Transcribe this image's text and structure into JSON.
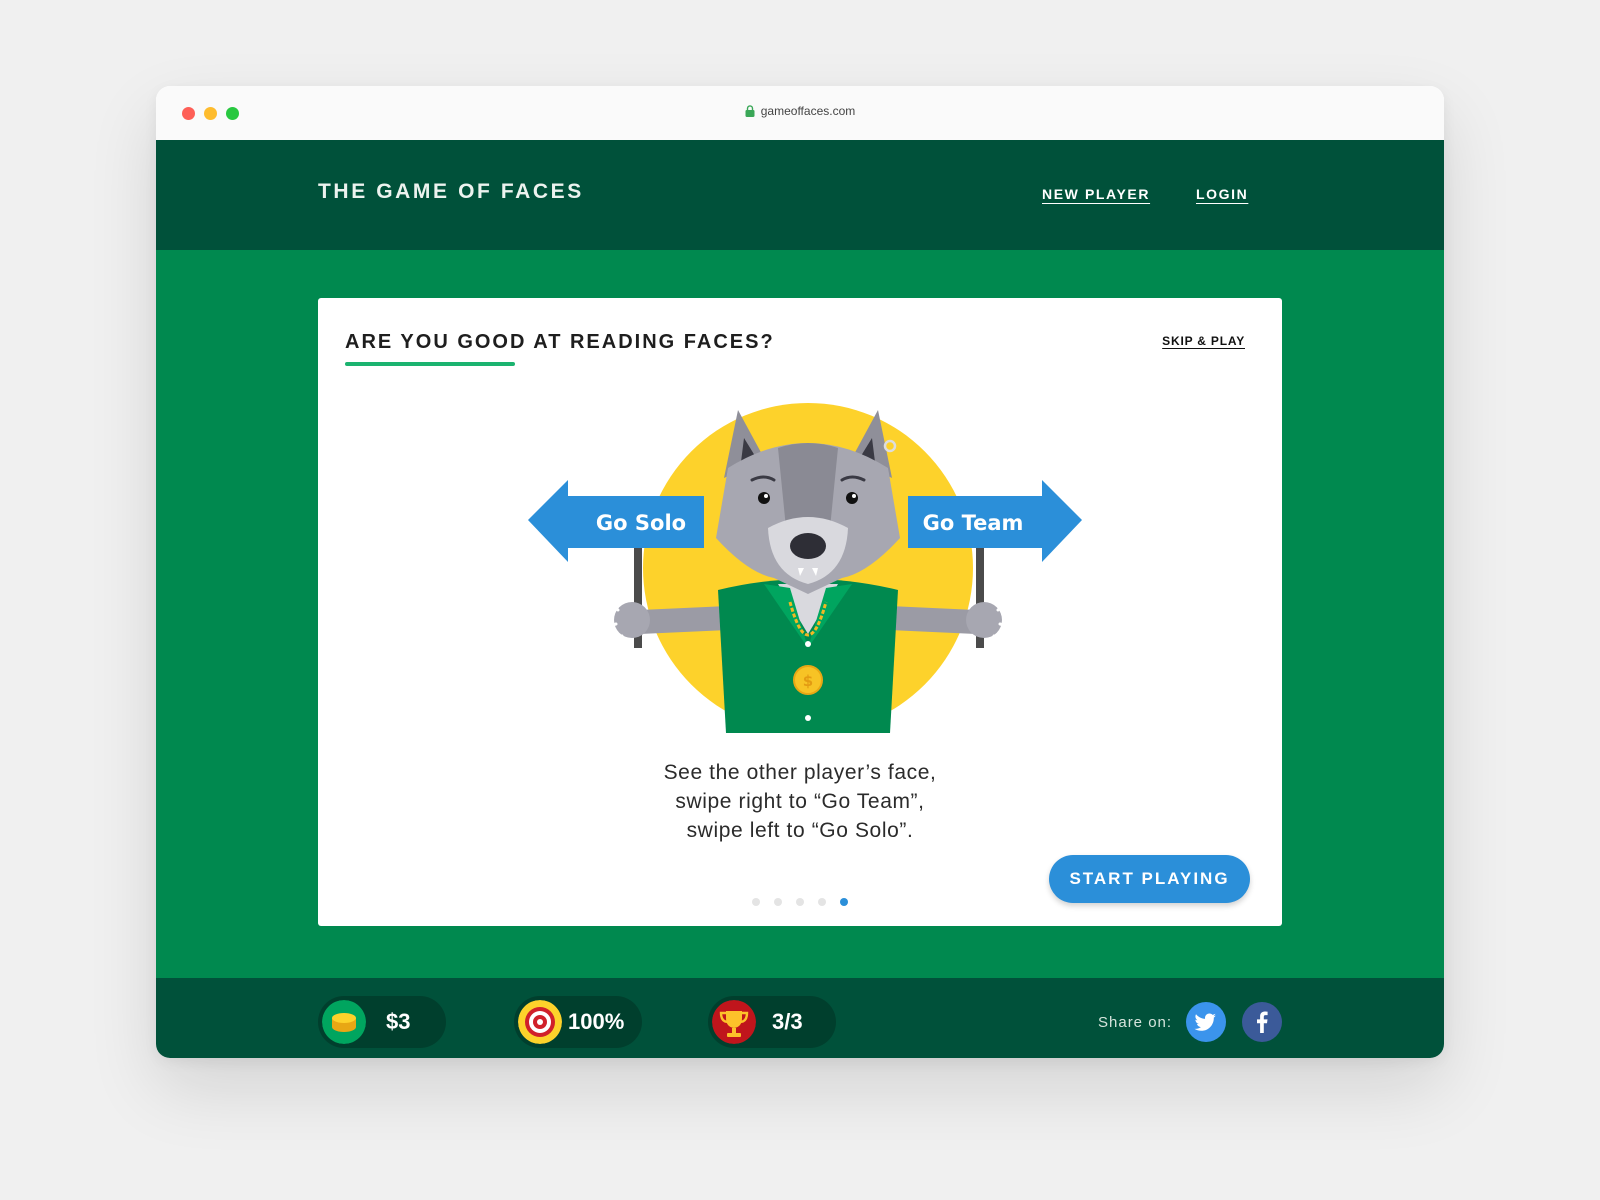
{
  "browser": {
    "url": "gameoffaces.com"
  },
  "header": {
    "brand": "THE GAME OF FACES",
    "nav": {
      "new_player": "NEW PLAYER",
      "login": "LOGIN"
    }
  },
  "card": {
    "title": "ARE YOU GOOD AT READING FACES?",
    "skip": "SKIP & PLAY",
    "signs": {
      "left": "Go Solo",
      "right": "Go Team"
    },
    "caption": [
      "See the other player’s face,",
      "swipe right to “Go Team”,",
      "swipe left to “Go Solo”."
    ],
    "start": "START PLAYING",
    "pager": {
      "total": 5,
      "active": 4
    }
  },
  "footer": {
    "stats": {
      "money": "$3",
      "accuracy": "100%",
      "trophies": "3/3"
    },
    "share_label": "Share on:"
  },
  "colors": {
    "header": "#00513a",
    "stage": "#00894f",
    "accent": "#2b8fd9",
    "underline": "#1bb36f",
    "sun": "#fdd22b"
  },
  "icons": [
    "lock-icon",
    "coin-icon",
    "target-icon",
    "trophy-icon",
    "twitter-icon",
    "facebook-icon"
  ]
}
